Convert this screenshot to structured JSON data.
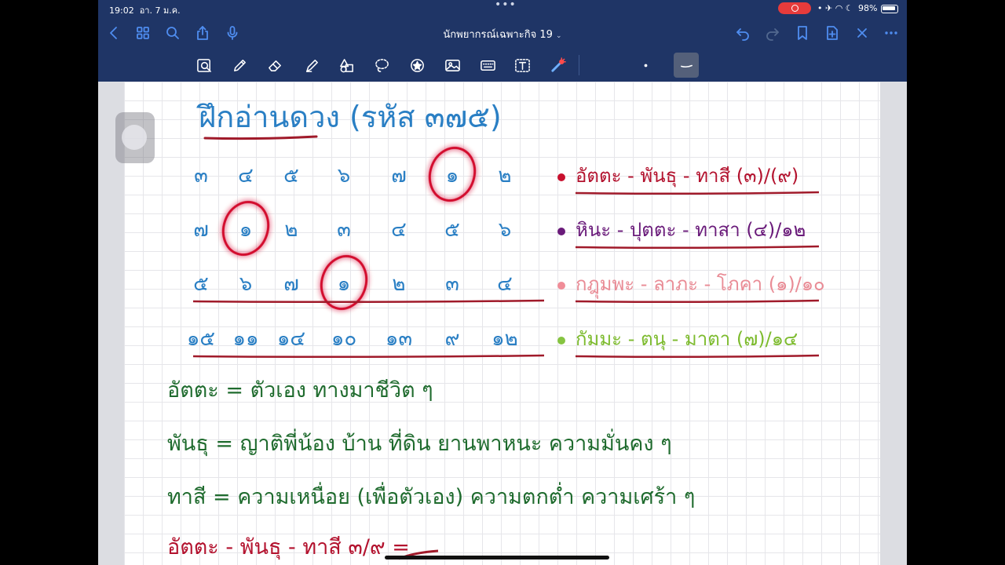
{
  "status_bar": {
    "time": "19:02",
    "date": "อา. 7 ม.ค.",
    "battery": "98%",
    "sys_icons": "• ✈ ◠ ☾"
  },
  "nav": {
    "title": "นักพยากรณ์เฉพาะกิจ 19",
    "icons": [
      "back-chevron-icon",
      "grid-icon",
      "search-icon",
      "share-icon",
      "mic-icon",
      "undo-icon",
      "redo-icon",
      "bookmark-icon",
      "add-page-icon",
      "close-icon",
      "more-icon"
    ]
  },
  "toolbar": {
    "tools": [
      "lasso-zoom-icon",
      "pen-icon",
      "eraser-icon",
      "highlighter-icon",
      "shapes-icon",
      "lasso-icon",
      "sticker-icon",
      "image-icon",
      "keyboard-icon",
      "text-icon",
      "laser-pointer-icon"
    ]
  },
  "note": {
    "title": "ฝึกอ่านดวง (รหัส ๓๗๕)",
    "grid_rows": [
      {
        "cells": [
          "๓",
          "๔",
          "๕",
          "๖",
          "๗",
          "๑",
          "๒"
        ],
        "circled_index": 5,
        "label": "อัตตะ - พันธุ - ทาสี (๓)/(๙)",
        "label_color": "#b3122e",
        "bullet_color": "#c8102e"
      },
      {
        "cells": [
          "๗",
          "๑",
          "๒",
          "๓",
          "๔",
          "๕",
          "๖"
        ],
        "circled_index": 1,
        "label": "หินะ - ปุตตะ - ทาสา (๔)/๑๒",
        "label_color": "#6a1b7a",
        "bullet_color": "#6a1b7a"
      },
      {
        "cells": [
          "๕",
          "๖",
          "๗",
          "๑",
          "๒",
          "๓",
          "๔"
        ],
        "circled_index": 3,
        "label": "กฎุมพะ - ลาภะ - โภคา (๑)/๑๐",
        "label_color": "#e98c96",
        "bullet_color": "#f08d98"
      },
      {
        "cells": [
          "๑๕",
          "๑๑",
          "๑๔",
          "๑๐",
          "๑๓",
          "๙",
          "๑๒"
        ],
        "circled_index": -1,
        "label": "กัมมะ - ตนุ - มาตา (๗)/๑๔",
        "label_color": "#7dbb2e",
        "bullet_color": "#86c441"
      }
    ],
    "notes": [
      "อัตตะ = ตัวเอง ทางมาชีวิต ๆ",
      "พันธุ = ญาติพี่น้อง บ้าน ที่ดิน ยานพาหนะ ความมั่นคง ๆ",
      "ทาสี = ความเหนื่อย (เพื่อตัวเอง) ความตกต่ำ ความเศร้า ๆ",
      "อัตตะ - พันธุ - ทาสี ๓/๙ ="
    ],
    "colors": {
      "number_ink": "#2a7fc4",
      "note_ink": "#1f6b2e",
      "underline": "#a01a2a",
      "circle": "#d3112f",
      "title_ink": "#2a7fc4"
    }
  }
}
